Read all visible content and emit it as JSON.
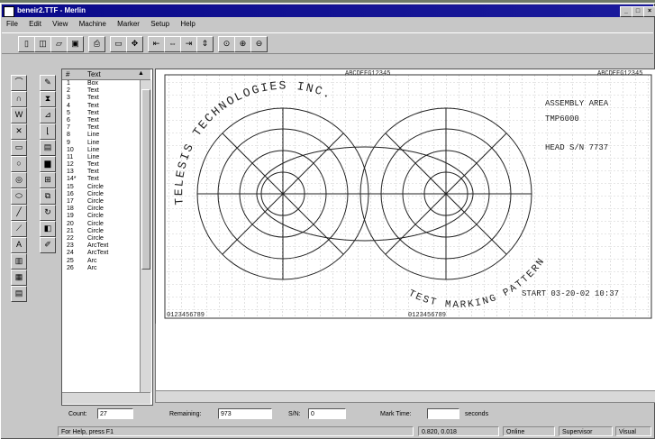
{
  "title": "beneir2.TTF - Merlin",
  "menu": [
    "File",
    "Edit",
    "View",
    "Machine",
    "Marker",
    "Setup",
    "Help"
  ],
  "list": {
    "col_num": "#",
    "col_text": "Text",
    "rows": [
      {
        "n": "1",
        "t": "Box"
      },
      {
        "n": "2",
        "t": "Text"
      },
      {
        "n": "3",
        "t": "Text"
      },
      {
        "n": "4",
        "t": "Text"
      },
      {
        "n": "5",
        "t": "Text"
      },
      {
        "n": "6",
        "t": "Text"
      },
      {
        "n": "7",
        "t": "Text"
      },
      {
        "n": "8",
        "t": "Line"
      },
      {
        "n": "9",
        "t": "Line"
      },
      {
        "n": "10",
        "t": "Line"
      },
      {
        "n": "11",
        "t": "Line"
      },
      {
        "n": "12",
        "t": "Text"
      },
      {
        "n": "13",
        "t": "Text"
      },
      {
        "n": "14*",
        "t": "Text"
      },
      {
        "n": "15",
        "t": "Circle"
      },
      {
        "n": "16",
        "t": "Circle"
      },
      {
        "n": "17",
        "t": "Circle"
      },
      {
        "n": "18",
        "t": "Circle"
      },
      {
        "n": "19",
        "t": "Circle"
      },
      {
        "n": "20",
        "t": "Circle"
      },
      {
        "n": "21",
        "t": "Circle"
      },
      {
        "n": "22",
        "t": "Circle"
      },
      {
        "n": "23",
        "t": "ArcText"
      },
      {
        "n": "24",
        "t": "ArcText"
      },
      {
        "n": "25",
        "t": "Arc"
      },
      {
        "n": "26",
        "t": "Arc"
      }
    ]
  },
  "canvas": {
    "top_text_1": "ABCDEFG12345",
    "top_text_2": "ABCDEFG12345",
    "arc_text_top": "TELESIS TECHNOLOGIES INC.",
    "arc_text_bottom": "TEST MARKING PATTERN",
    "assembly_1": "ASSEMBLY AREA",
    "assembly_2": "TMP6000",
    "head_sn": "HEAD S/N 7737",
    "start": "START 03-20-02 10:37",
    "bottom_num_1": "0123456789",
    "bottom_num_2": "0123456789"
  },
  "fields": {
    "count_label": "Count:",
    "count_value": "27",
    "remaining_label": "Remaining:",
    "remaining_value": "973",
    "sn_label": "S/N:",
    "sn_value": "0",
    "marktime_label": "Mark Time:",
    "marktime_value": "",
    "seconds_label": "seconds"
  },
  "status": {
    "help": "For Help, press F1",
    "coords": "0.820, 0.018",
    "mode": "Online",
    "user": "Supervisor",
    "view": "Visual"
  }
}
